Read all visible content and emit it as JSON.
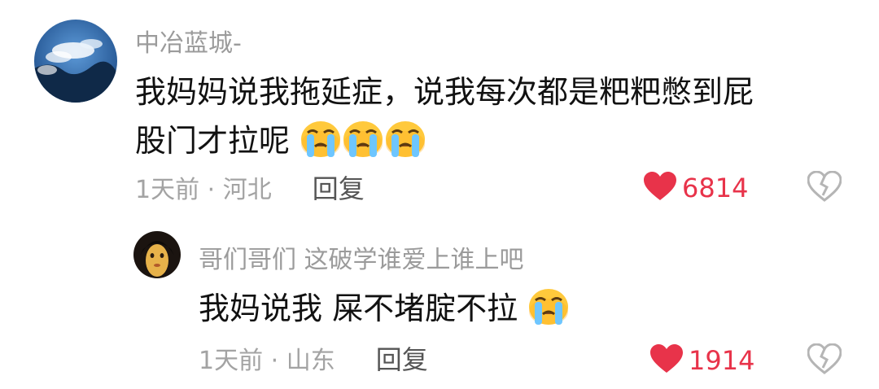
{
  "comment": {
    "username": "中冶蓝城-",
    "line1": "我妈妈说我拖延症，说我每次都是粑粑憋到屁",
    "line2": "股门才拉呢",
    "emoji_count": 3,
    "emoji_icon": "crying-face-emoji",
    "time_location": "1天前 · 河北",
    "reply_label": "回复",
    "likes": "6814"
  },
  "reply": {
    "username": "哥们哥们 这破学谁爱上谁上吧",
    "text": "我妈说我 屎不堵腚不拉",
    "emoji_icon": "crying-face-emoji",
    "time_location": "1天前 · 山东",
    "reply_label": "回复",
    "likes": "1914"
  },
  "icons": {
    "like": "heart-icon",
    "dislike": "broken-heart-icon"
  },
  "colors": {
    "like": "#e8334a",
    "meta": "#a3a3a3",
    "username": "#9b9b9b",
    "text": "#111111"
  }
}
